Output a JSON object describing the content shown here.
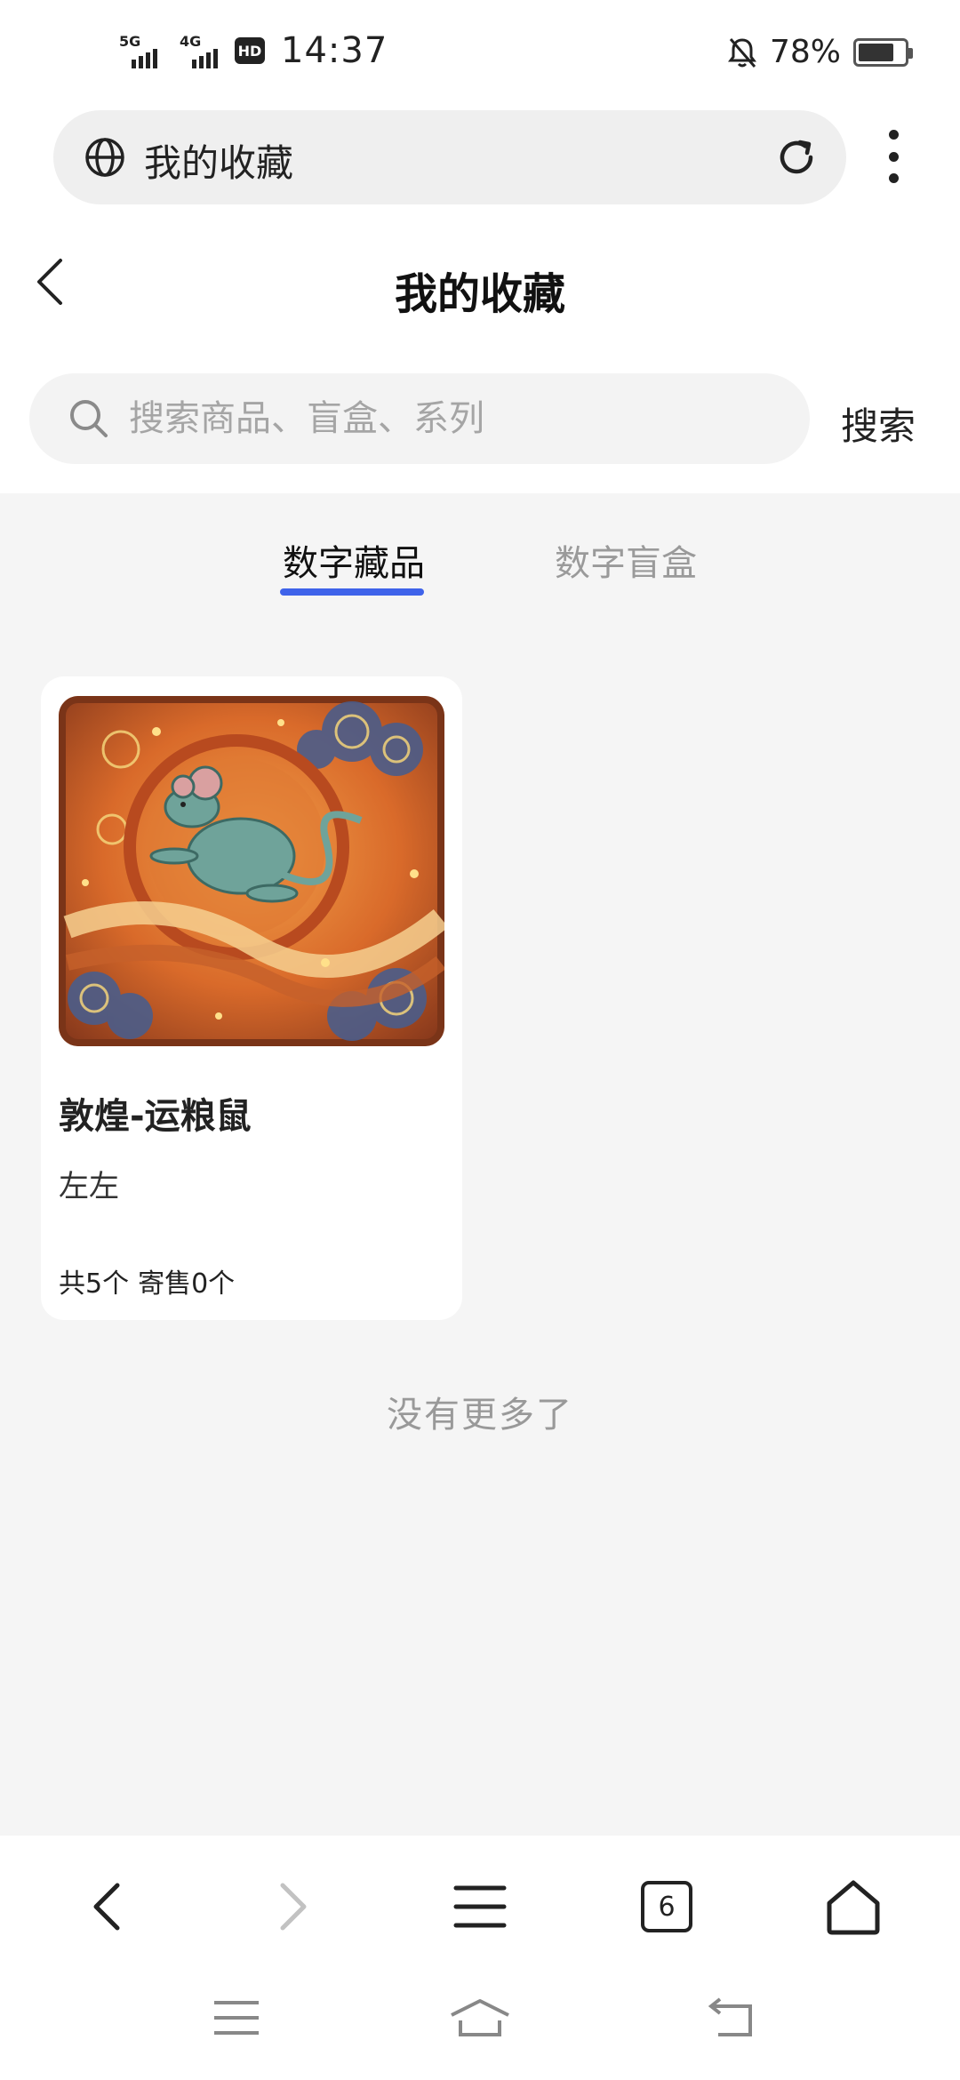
{
  "status_bar": {
    "signal1": "5G",
    "signal2": "4G",
    "hd_label": "HD",
    "time": "14:37",
    "battery_text": "78%",
    "battery_level": 0.78
  },
  "browser": {
    "url_text": "我的收藏",
    "tab_count": "6"
  },
  "header": {
    "title": "我的收藏"
  },
  "search": {
    "placeholder": "搜索商品、盲盒、系列",
    "button_label": "搜索"
  },
  "tabs": [
    {
      "label": "数字藏品",
      "active": true
    },
    {
      "label": "数字盲盒",
      "active": false
    }
  ],
  "items": [
    {
      "title": "敦煌-运粮鼠",
      "author": "左左",
      "total": "共5个",
      "on_sale": "寄售0个"
    }
  ],
  "footer_text": "没有更多了",
  "colors": {
    "accent": "#3f63ea",
    "content_bg": "#f5f5f5",
    "inactive_text": "#9a9a9a"
  }
}
